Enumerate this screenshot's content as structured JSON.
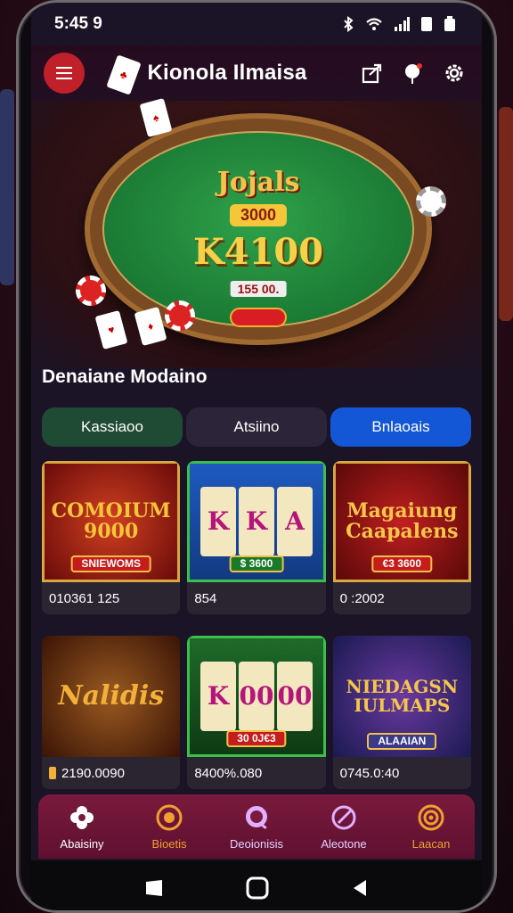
{
  "status_bar": {
    "time": "5:45 9"
  },
  "topbar": {
    "title": "Kionola Ilmaisa"
  },
  "hero": {
    "headline": "Jojals",
    "pill": "3000",
    "amount": "K4100",
    "tag": "155 00."
  },
  "section": {
    "title": "Denaiane Modaino"
  },
  "tabs": [
    {
      "label": "Kassiaoo"
    },
    {
      "label": "Atsiino"
    },
    {
      "label": "Bnlaoais"
    }
  ],
  "games": [
    {
      "art_title": "COMOIUM 9000",
      "ribbon": "SNIEWOMS",
      "value": "010361 125",
      "art_color": "#8a1a1a",
      "text_color": "#f5c53a"
    },
    {
      "art_title": "K K A",
      "ribbon": "$ 3600",
      "value": "854",
      "art_color": "#2450b0",
      "text_color": "#d92f82"
    },
    {
      "art_title": "Magaiung Caapalens",
      "ribbon": "€3 3600",
      "value": "0 :2002",
      "art_color": "#8a1212",
      "text_color": "#f6c64a"
    },
    {
      "art_title": "Nalidis",
      "ribbon": "",
      "value": "2190.0090",
      "art_color": "#5a2a10",
      "text_color": "#f2b03a"
    },
    {
      "art_title": "K 00 00",
      "ribbon": "30 0J€3",
      "value": "8400%.080",
      "art_color": "#1e6a2a",
      "text_color": "#b5157a"
    },
    {
      "art_title": "NIEDAGSN IULMAPS",
      "ribbon": "ALAAIAN",
      "value": "0745.0:40",
      "art_color": "#2a2a7a",
      "text_color": "#f6c64a"
    }
  ],
  "bottom_nav": [
    {
      "label": "Abaisiny",
      "icon": "flower-icon",
      "color": "#ffffff"
    },
    {
      "label": "Bioetis",
      "icon": "sun-icon",
      "color": "#f0a030"
    },
    {
      "label": "Deoionisis",
      "icon": "chat-icon",
      "color": "#e0b0ff"
    },
    {
      "label": "Aleotone",
      "icon": "compass-icon",
      "color": "#e0b0ff"
    },
    {
      "label": "Laacan",
      "icon": "target-icon",
      "color": "#f0a030"
    }
  ]
}
